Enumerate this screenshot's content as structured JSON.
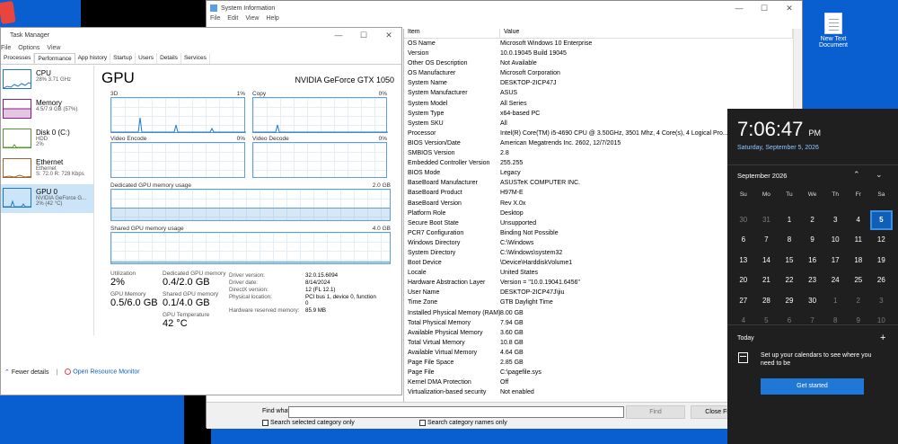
{
  "desktop": {
    "icon_label_1": "New Text",
    "icon_label_2": "Document"
  },
  "taskmanager": {
    "title": "Task Manager",
    "menu": [
      "File",
      "Options",
      "View"
    ],
    "tabs": [
      "Processes",
      "Performance",
      "App history",
      "Startup",
      "Users",
      "Details",
      "Services"
    ],
    "sidebar": [
      {
        "title": "CPU",
        "sub1": "28% 3.71 GHz",
        "sub2": "",
        "color": "#1f7ac6"
      },
      {
        "title": "Memory",
        "sub1": "4.5/7.9 GB (57%)",
        "sub2": "",
        "color": "#8b1a8b"
      },
      {
        "title": "Disk 0 (C:)",
        "sub1": "HDD",
        "sub2": "2%",
        "color": "#4e9a2e"
      },
      {
        "title": "Ethernet",
        "sub1": "Ethernet",
        "sub2": "S: 72.0 R: 728 Kbps",
        "color": "#a6642b"
      },
      {
        "title": "GPU 0",
        "sub1": "NVIDIA GeForce G...",
        "sub2": "2% (42 °C)",
        "color": "#1f7ac6"
      }
    ],
    "gpu": {
      "heading": "GPU",
      "model": "NVIDIA GeForce GTX 1050",
      "engine_3d": "3D",
      "engine_3d_pct": "1%",
      "engine_copy": "Copy",
      "engine_copy_pct": "0%",
      "engine_enc": "Video Encode",
      "engine_enc_pct": "0%",
      "engine_dec": "Video Decode",
      "engine_dec_pct": "0%",
      "dedicated_label": "Dedicated GPU memory usage",
      "dedicated_max": "2.0 GB",
      "shared_label": "Shared GPU memory usage",
      "shared_max": "4.0 GB",
      "utilization_label": "Utilization",
      "utilization": "2%",
      "ded_mem_label": "Dedicated GPU memory",
      "ded_mem": "0.4/2.0 GB",
      "gpu_mem_label": "GPU Memory",
      "gpu_mem": "0.5/6.0 GB",
      "shr_mem_label": "Shared GPU memory",
      "shr_mem": "0.1/4.0 GB",
      "temp_label": "GPU Temperature",
      "temp": "42 °C",
      "details": [
        [
          "Driver version:",
          "32.0.15.6094"
        ],
        [
          "Driver date:",
          "8/14/2024"
        ],
        [
          "DirectX version:",
          "12 (FL 12.1)"
        ],
        [
          "Physical location:",
          "PCI bus 1, device 0, function 0"
        ],
        [
          "Hardware reserved memory:",
          "85.9 MB"
        ]
      ]
    },
    "fewer_details": "Fewer details",
    "open_monitor": "Open Resource Monitor"
  },
  "sysinfo": {
    "title": "System Information",
    "menu": [
      "File",
      "Edit",
      "View",
      "Help"
    ],
    "col_item": "Item",
    "col_value": "Value",
    "rows": [
      [
        "OS Name",
        "Microsoft Windows 10 Enterprise"
      ],
      [
        "Version",
        "10.0.19045 Build 19045"
      ],
      [
        "Other OS Description",
        "Not Available"
      ],
      [
        "OS Manufacturer",
        "Microsoft Corporation"
      ],
      [
        "System Name",
        "DESKTOP-2ICP47J"
      ],
      [
        "System Manufacturer",
        "ASUS"
      ],
      [
        "System Model",
        "All Series"
      ],
      [
        "System Type",
        "x64-based PC"
      ],
      [
        "System SKU",
        "All"
      ],
      [
        "Processor",
        "Intel(R) Core(TM) i5-4690 CPU @ 3.50GHz, 3501 Mhz, 4 Core(s), 4 Logical Pro..."
      ],
      [
        "BIOS Version/Date",
        "American Megatrends Inc. 2602, 12/7/2015"
      ],
      [
        "SMBIOS Version",
        "2.8"
      ],
      [
        "Embedded Controller Version",
        "255.255"
      ],
      [
        "BIOS Mode",
        "Legacy"
      ],
      [
        "BaseBoard Manufacturer",
        "ASUSTeK COMPUTER INC."
      ],
      [
        "BaseBoard Product",
        "H97M-E"
      ],
      [
        "BaseBoard Version",
        "Rev X.0x"
      ],
      [
        "Platform Role",
        "Desktop"
      ],
      [
        "Secure Boot State",
        "Unsupported"
      ],
      [
        "PCR7 Configuration",
        "Binding Not Possible"
      ],
      [
        "Windows Directory",
        "C:\\Windows"
      ],
      [
        "System Directory",
        "C:\\Windows\\system32"
      ],
      [
        "Boot Device",
        "\\Device\\HarddiskVolume1"
      ],
      [
        "Locale",
        "United States"
      ],
      [
        "Hardware Abstraction Layer",
        "Version = \"10.0.19041.6456\""
      ],
      [
        "User Name",
        "DESKTOP-2ICP47J\\jiu"
      ],
      [
        "Time Zone",
        "GTB Daylight Time"
      ],
      [
        "Installed Physical Memory (RAM)",
        "8.00 GB"
      ],
      [
        "Total Physical Memory",
        "7.94 GB"
      ],
      [
        "Available Physical Memory",
        "3.60 GB"
      ],
      [
        "Total Virtual Memory",
        "10.8 GB"
      ],
      [
        "Available Virtual Memory",
        "4.64 GB"
      ],
      [
        "Page File Space",
        "2.85 GB"
      ],
      [
        "Page File",
        "C:\\pagefile.sys"
      ],
      [
        "Kernel DMA Protection",
        "Off"
      ],
      [
        "Virtualization-based security",
        "Not enabled"
      ]
    ],
    "find_label": "Find what:",
    "find_value": "",
    "find_button": "Find",
    "close_find": "Close Find",
    "chk_selected": "Search selected category only",
    "chk_names": "Search category names only"
  },
  "clock": {
    "time": "7:06:47",
    "ampm": "PM",
    "date": "Saturday, September 5, 2026",
    "month": "September 2026",
    "dow": [
      "Su",
      "Mo",
      "Tu",
      "We",
      "Th",
      "Fr",
      "Sa"
    ],
    "days": [
      "30",
      "31",
      "1",
      "2",
      "3",
      "4",
      "5",
      "6",
      "7",
      "8",
      "9",
      "10",
      "11",
      "12",
      "13",
      "14",
      "15",
      "16",
      "17",
      "18",
      "19",
      "20",
      "21",
      "22",
      "23",
      "24",
      "25",
      "26",
      "27",
      "28",
      "29",
      "30",
      "1",
      "2",
      "3",
      "4",
      "5",
      "6",
      "7",
      "8",
      "9",
      "10"
    ],
    "today_label": "Today",
    "message": "Set up your calendars to see where you need to be",
    "button": "Get started"
  }
}
